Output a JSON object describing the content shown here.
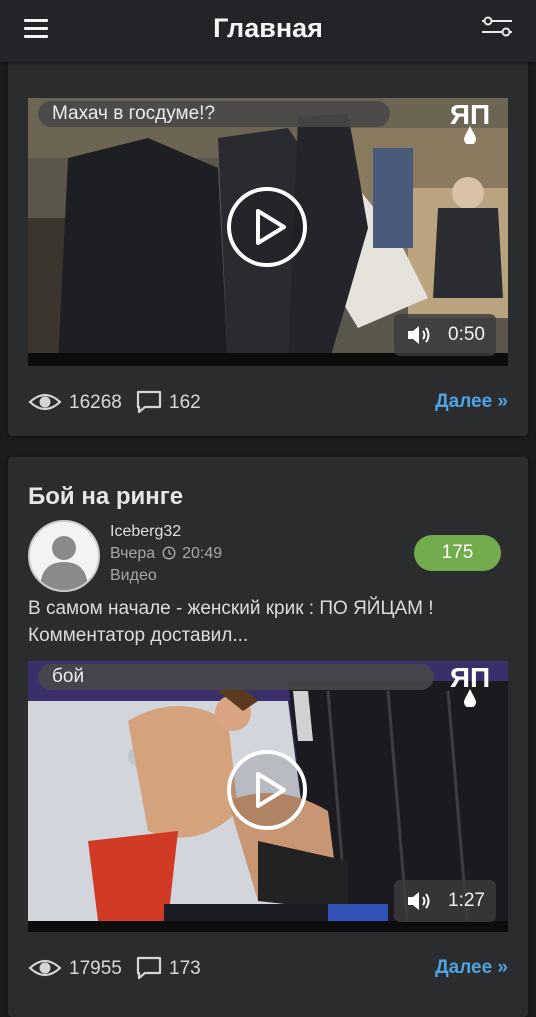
{
  "header": {
    "title": "Главная",
    "menu_icon": "hamburger-menu-icon",
    "filter_icon": "filter-sliders-icon"
  },
  "posts": [
    {
      "video": {
        "caption": "Махач в госдуме!?",
        "logo": "ЯП",
        "duration": "0:50"
      },
      "stats": {
        "views": "16268",
        "comments": "162",
        "more_label": "Далее »"
      }
    },
    {
      "title": "Бой на ринге",
      "author": "Iceberg32",
      "date_day": "Вчера",
      "date_time": "20:49",
      "category": "Видео",
      "rating": "175",
      "excerpt_line1": "В самом начале - женский крик : ПО ЯЙЦАМ !",
      "excerpt_line2": "Комментатор доставил...",
      "video": {
        "caption": "бой",
        "logo": "ЯП",
        "duration": "1:27"
      },
      "stats": {
        "views": "17955",
        "comments": "173",
        "more_label": "Далее »"
      }
    }
  ],
  "colors": {
    "background": "#1b1c1e",
    "card": "#2b2c2e",
    "link": "#4fa3e0",
    "rating_badge": "#72ac4c"
  }
}
